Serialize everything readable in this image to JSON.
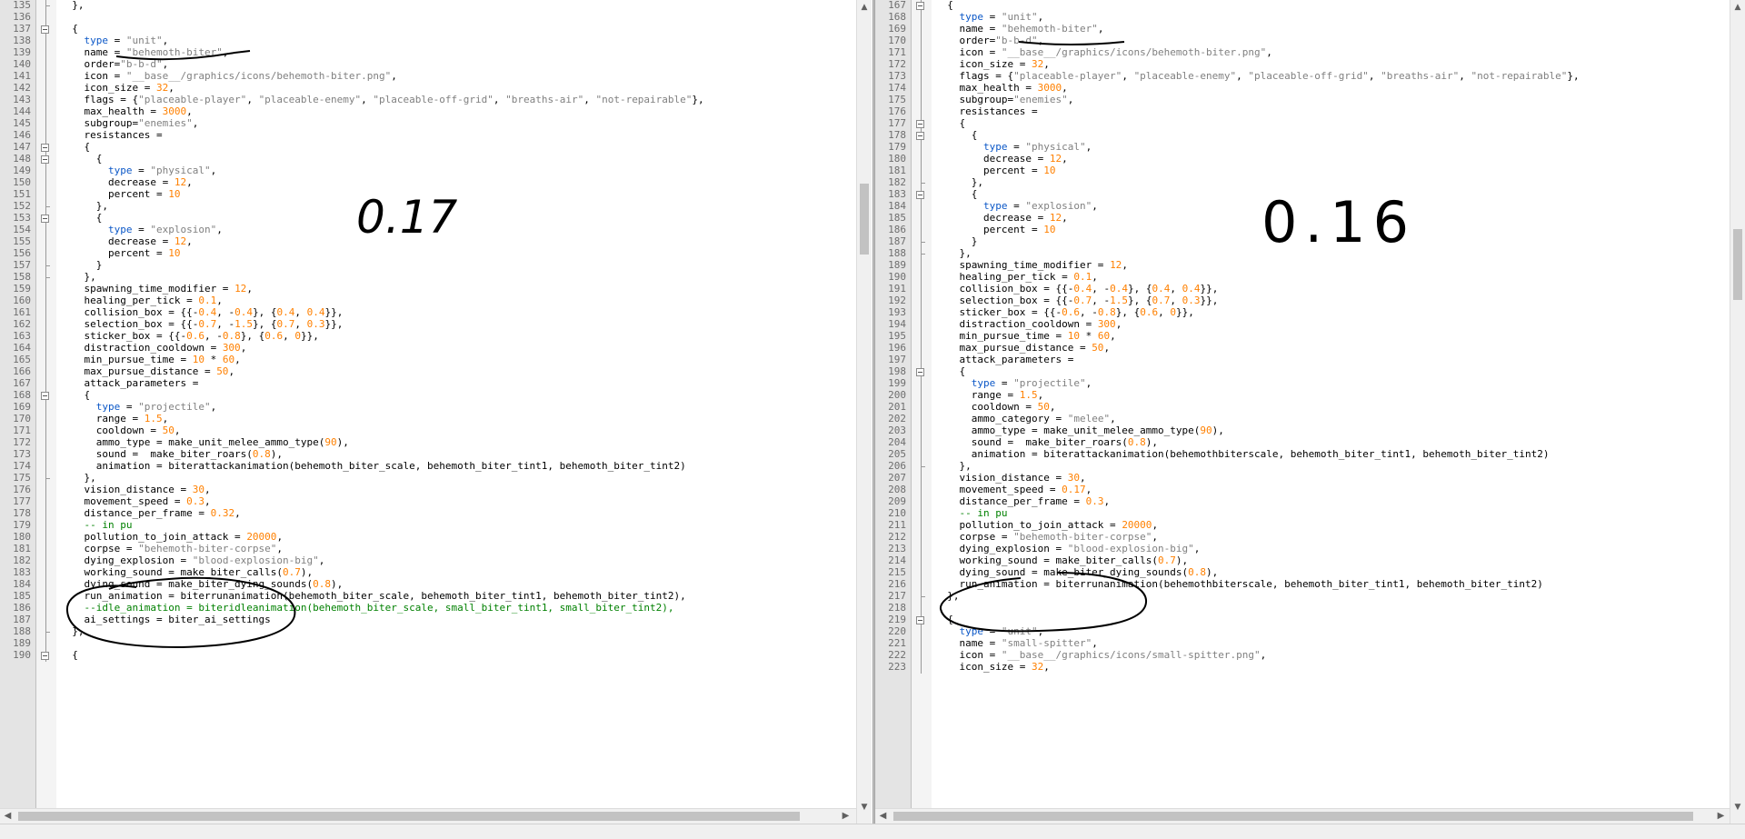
{
  "left_pane": {
    "first_line": 135,
    "handwritten_note": "0.17",
    "lines": [
      "  },",
      "",
      "  {",
      "    type = \"unit\",",
      "    name = \"behemoth-biter\",",
      "    order=\"b-b-d\",",
      "    icon = \"__base__/graphics/icons/behemoth-biter.png\",",
      "    icon_size = 32,",
      "    flags = {\"placeable-player\", \"placeable-enemy\", \"placeable-off-grid\", \"breaths-air\", \"not-repairable\"},",
      "    max_health = 3000,",
      "    subgroup=\"enemies\",",
      "    resistances =",
      "    {",
      "      {",
      "        type = \"physical\",",
      "        decrease = 12,",
      "        percent = 10",
      "      },",
      "      {",
      "        type = \"explosion\",",
      "        decrease = 12,",
      "        percent = 10",
      "      }",
      "    },",
      "    spawning_time_modifier = 12,",
      "    healing_per_tick = 0.1,",
      "    collision_box = {{-0.4, -0.4}, {0.4, 0.4}},",
      "    selection_box = {{-0.7, -1.5}, {0.7, 0.3}},",
      "    sticker_box = {{-0.6, -0.8}, {0.6, 0}},",
      "    distraction_cooldown = 300,",
      "    min_pursue_time = 10 * 60,",
      "    max_pursue_distance = 50,",
      "    attack_parameters =",
      "    {",
      "      type = \"projectile\",",
      "      range = 1.5,",
      "      cooldown = 50,",
      "      ammo_type = make_unit_melee_ammo_type(90),",
      "      sound =  make_biter_roars(0.8),",
      "      animation = biterattackanimation(behemoth_biter_scale, behemoth_biter_tint1, behemoth_biter_tint2)",
      "    },",
      "    vision_distance = 30,",
      "    movement_speed = 0.3,",
      "    distance_per_frame = 0.32,",
      "    -- in pu",
      "    pollution_to_join_attack = 20000,",
      "    corpse = \"behemoth-biter-corpse\",",
      "    dying_explosion = \"blood-explosion-big\",",
      "    working_sound = make_biter_calls(0.7),",
      "    dying_sound = make_biter_dying_sounds(0.8),",
      "    run_animation = biterrunanimation(behemoth_biter_scale, behemoth_biter_tint1, behemoth_biter_tint2),",
      "    --idle_animation = biteridleanimation(behemoth_biter_scale, small_biter_tint1, small_biter_tint2),",
      "    ai_settings = biter_ai_settings",
      "  },",
      "",
      "  {"
    ]
  },
  "right_pane": {
    "first_line": 167,
    "handwritten_note": "0.16",
    "lines": [
      "  {",
      "    type = \"unit\",",
      "    name = \"behemoth-biter\",",
      "    order=\"b-b-d\",",
      "    icon = \"__base__/graphics/icons/behemoth-biter.png\",",
      "    icon_size = 32,",
      "    flags = {\"placeable-player\", \"placeable-enemy\", \"placeable-off-grid\", \"breaths-air\", \"not-repairable\"},",
      "    max_health = 3000,",
      "    subgroup=\"enemies\",",
      "    resistances =",
      "    {",
      "      {",
      "        type = \"physical\",",
      "        decrease = 12,",
      "        percent = 10",
      "      },",
      "      {",
      "        type = \"explosion\",",
      "        decrease = 12,",
      "        percent = 10",
      "      }",
      "    },",
      "    spawning_time_modifier = 12,",
      "    healing_per_tick = 0.1,",
      "    collision_box = {{-0.4, -0.4}, {0.4, 0.4}},",
      "    selection_box = {{-0.7, -1.5}, {0.7, 0.3}},",
      "    sticker_box = {{-0.6, -0.8}, {0.6, 0}},",
      "    distraction_cooldown = 300,",
      "    min_pursue_time = 10 * 60,",
      "    max_pursue_distance = 50,",
      "    attack_parameters =",
      "    {",
      "      type = \"projectile\",",
      "      range = 1.5,",
      "      cooldown = 50,",
      "      ammo_category = \"melee\",",
      "      ammo_type = make_unit_melee_ammo_type(90),",
      "      sound =  make_biter_roars(0.8),",
      "      animation = biterattackanimation(behemothbiterscale, behemoth_biter_tint1, behemoth_biter_tint2)",
      "    },",
      "    vision_distance = 30,",
      "    movement_speed = 0.17,",
      "    distance_per_frame = 0.3,",
      "    -- in pu",
      "    pollution_to_join_attack = 20000,",
      "    corpse = \"behemoth-biter-corpse\",",
      "    dying_explosion = \"blood-explosion-big\",",
      "    working_sound = make_biter_calls(0.7),",
      "    dying_sound = make_biter_dying_sounds(0.8),",
      "    run_animation = biterrunanimation(behemothbiterscale, behemoth_biter_tint1, behemoth_biter_tint2)",
      "  },",
      "",
      "  {",
      "    type = \"unit\",",
      "    name = \"small-spitter\",",
      "    icon = \"__base__/graphics/icons/small-spitter.png\",",
      "    icon_size = 32,"
    ]
  },
  "scrollbars": {
    "arrow_up": "▲",
    "arrow_down": "▼",
    "arrow_left": "◀",
    "arrow_right": "▶"
  },
  "colors": {
    "keyword": "#0b57c7",
    "string": "#808080",
    "number": "#ff8000",
    "comment": "#008000",
    "ink": "#000000"
  }
}
